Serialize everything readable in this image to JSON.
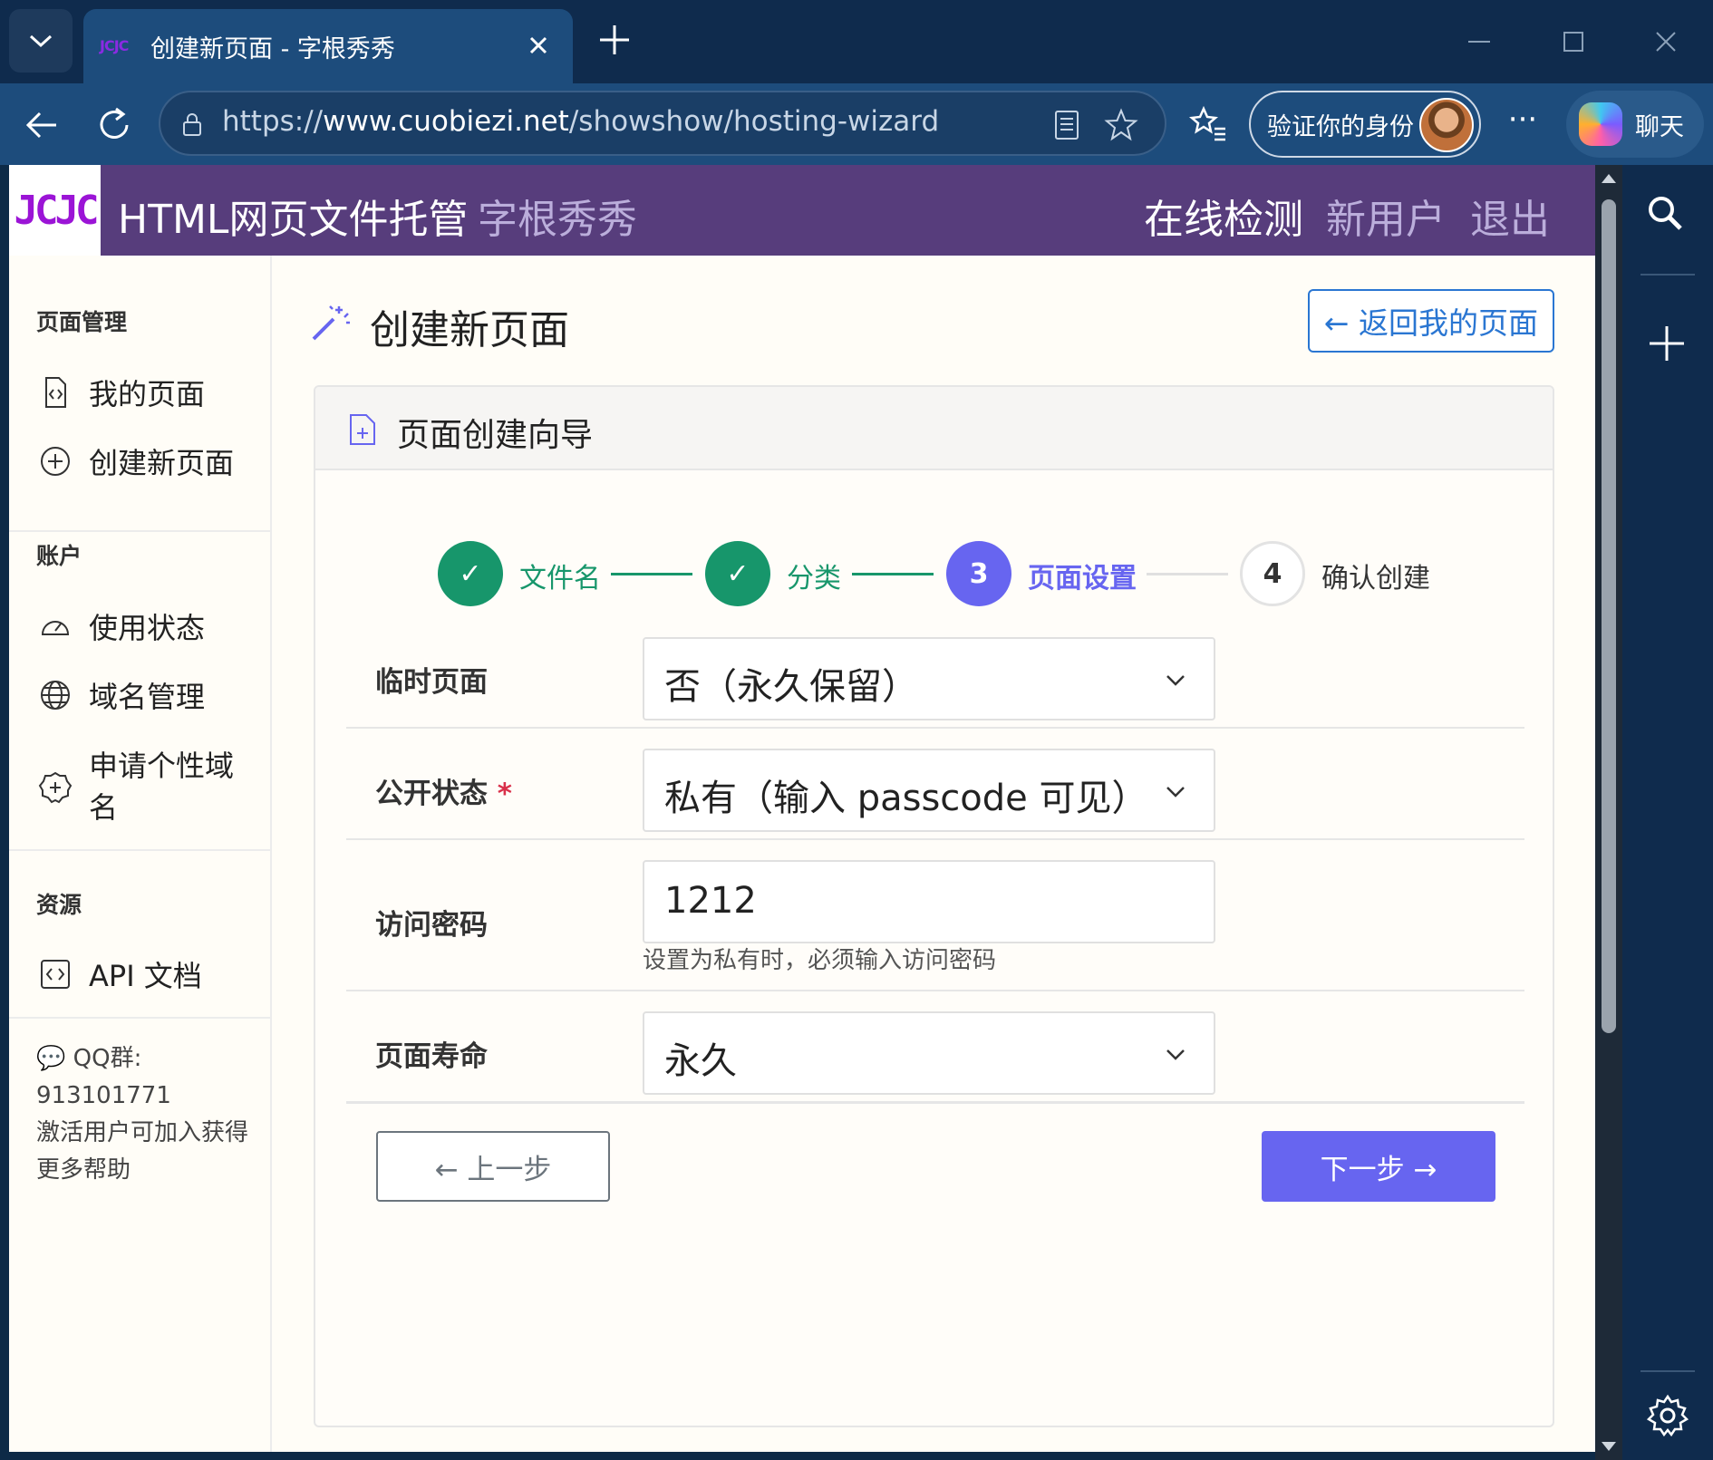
{
  "browser": {
    "tab_favicon": "JCJC",
    "tab_title": "创建新页面 - 字根秀秀",
    "url_prefix": "https://",
    "url_host": "www.cuobiezi.net",
    "url_path": "/showshow/hosting-wizard",
    "verify_label": "验证你的身份",
    "copilot_label": "聊天"
  },
  "topnav": {
    "logo": "JCJC",
    "brand": "HTML网页文件托管",
    "brand_sub": "字根秀秀",
    "links": [
      "在线检测",
      "新用户",
      "退出"
    ],
    "link_colors": [
      "#ffffff",
      "#bbaedb",
      "#bbaedb"
    ]
  },
  "sidebar": {
    "sections": [
      {
        "title": "页面管理",
        "items": [
          {
            "label": "我的页面",
            "icon": "file-code-icon"
          },
          {
            "label": "创建新页面",
            "icon": "plus-circle-icon"
          }
        ]
      },
      {
        "title": "账户",
        "items": [
          {
            "label": "使用状态",
            "icon": "speedometer-icon"
          },
          {
            "label": "域名管理",
            "icon": "globe-icon"
          },
          {
            "label": "申请个性域名",
            "icon": "badge-plus-icon"
          }
        ]
      },
      {
        "title": "资源",
        "items": [
          {
            "label": "API 文档",
            "icon": "code-square-icon"
          }
        ]
      }
    ],
    "note_line1": "💬 QQ群:",
    "note_line2": "913101771",
    "note_line3": "激活用户可加入获得更多帮助"
  },
  "main": {
    "title": "创建新页面",
    "back_button": "← 返回我的页面",
    "card_title": "页面创建向导",
    "steps": [
      {
        "mark": "✓",
        "label": "文件名",
        "state": "done"
      },
      {
        "mark": "✓",
        "label": "分类",
        "state": "done"
      },
      {
        "mark": "3",
        "label": "页面设置",
        "state": "active"
      },
      {
        "mark": "4",
        "label": "确认创建",
        "state": "pending"
      }
    ],
    "form": {
      "temp_label": "临时页面",
      "temp_value": "否（永久保留）",
      "public_label": "公开状态",
      "required_mark": "*",
      "public_value": "私有（输入 passcode 可见）",
      "password_label": "访问密码",
      "password_value": "1212",
      "password_help": "设置为私有时，必须输入访问密码",
      "life_label": "页面寿命",
      "life_value": "永久"
    },
    "prev_button": "←  上一步",
    "next_button": "下一步  →"
  },
  "colors": {
    "nav_bg": "#573d7c",
    "done": "#17966b",
    "active": "#6765f0",
    "link": "#2a76d2"
  }
}
